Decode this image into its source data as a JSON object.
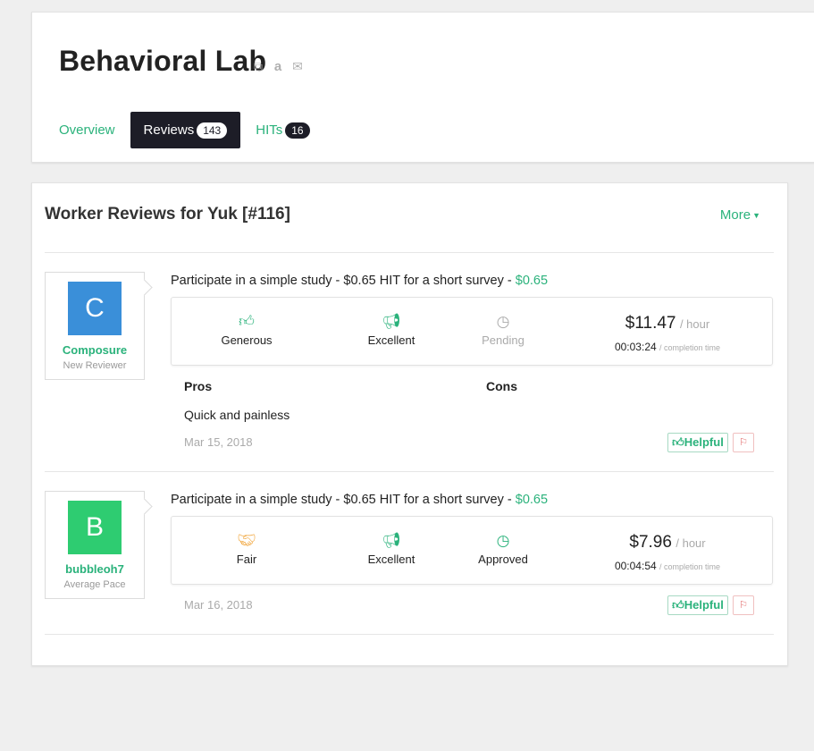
{
  "header": {
    "title": "Behavioral Lab",
    "icons": [
      "copy-icon",
      "amazon-icon",
      "envelope-icon"
    ],
    "tabs": [
      {
        "label": "Overview",
        "badge": ""
      },
      {
        "label": "Reviews",
        "badge": "143"
      },
      {
        "label": "HITs",
        "badge": "16"
      }
    ]
  },
  "reviews": {
    "heading": "Worker Reviews for Yuk [#116]",
    "more_label": "More",
    "items": [
      {
        "avatar_letter": "C",
        "avatar_color": "#3a8fd9",
        "reviewer_name": "Composure",
        "reviewer_type": "New Reviewer",
        "hit_title": "Participate in a simple study - $0.65 HIT for a short survey - ",
        "hit_reward": "$0.65",
        "ratings": [
          {
            "icon": "thumbs-up-icon",
            "label": "Generous"
          },
          {
            "icon": "megaphone-icon",
            "label": "Excellent"
          },
          {
            "icon": "clock-icon",
            "label": "Pending"
          }
        ],
        "hourly_rate": "$11.47",
        "per_hour": "/ hour",
        "completion_time": "00:03:24",
        "completion_label": "/ completion time",
        "pros_label": "Pros",
        "cons_label": "Cons",
        "pros": "Quick and painless",
        "cons": "",
        "date": "Mar 15, 2018",
        "helpful_label": "Helpful"
      },
      {
        "avatar_letter": "B",
        "avatar_color": "#2ecc71",
        "reviewer_name": "bubbleoh7",
        "reviewer_type": "Average Pace",
        "hit_title": "Participate in a simple study - $0.65 HIT for a short survey - ",
        "hit_reward": "$0.65",
        "ratings": [
          {
            "icon": "handshake-icon",
            "label": "Fair"
          },
          {
            "icon": "megaphone-icon",
            "label": "Excellent"
          },
          {
            "icon": "clock-icon",
            "label": "Approved"
          }
        ],
        "hourly_rate": "$7.96",
        "per_hour": "/ hour",
        "completion_time": "00:04:54",
        "completion_label": "/ completion time",
        "date": "Mar 16, 2018",
        "helpful_label": "Helpful"
      }
    ]
  },
  "colors": {
    "accent": "#2ab27b",
    "tab_active_bg": "#1d1d27",
    "fair_orange": "#f0a030"
  }
}
